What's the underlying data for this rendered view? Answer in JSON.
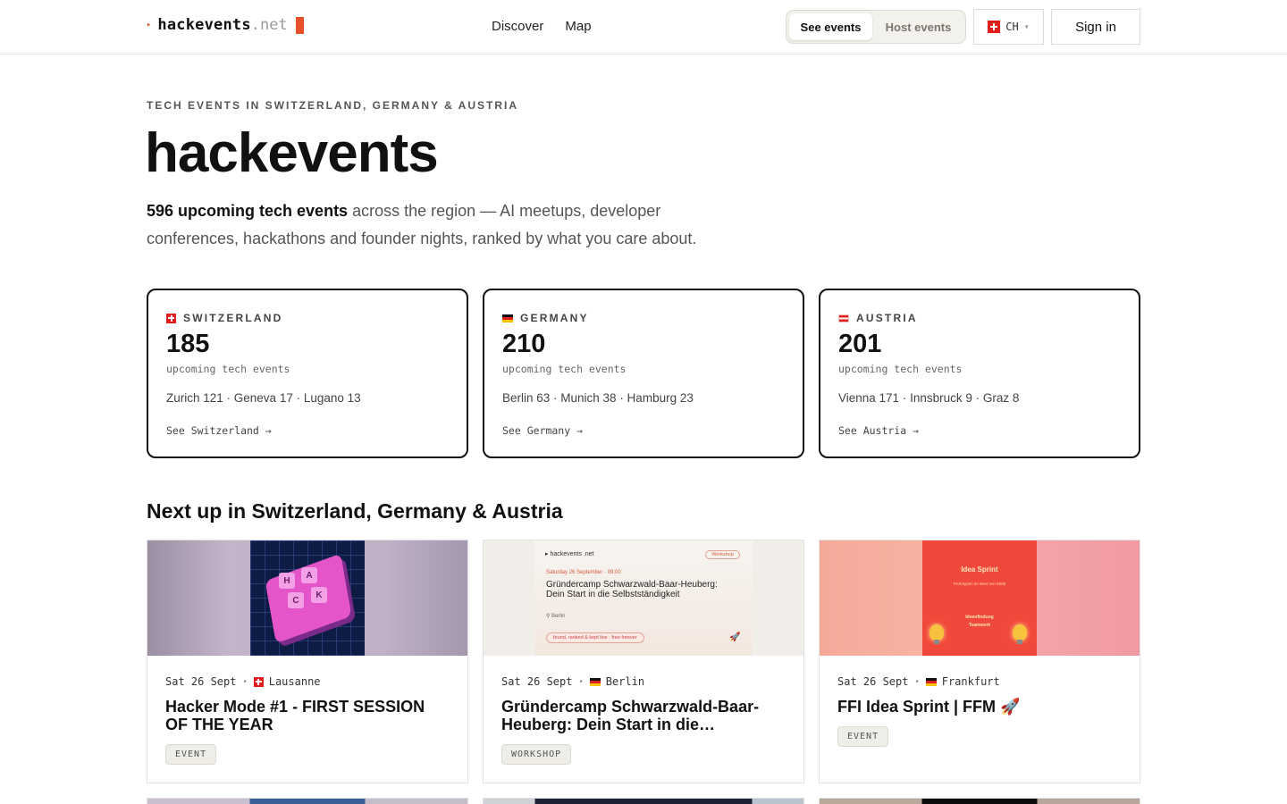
{
  "header": {
    "logo": {
      "arrow": "▸",
      "name": "hackevents",
      "tld": ".net"
    },
    "nav": [
      "Discover",
      "Map"
    ],
    "toggle": {
      "active": "See events",
      "inactive": "Host events"
    },
    "country_select": {
      "value": "CH",
      "caret": "▾"
    },
    "signin": "Sign in"
  },
  "hero": {
    "eyebrow": "TECH EVENTS IN SWITZERLAND, GERMANY & AUSTRIA",
    "title": "hackevents",
    "desc_bold": "596 upcoming tech events",
    "desc_rest": " across the region — AI meetups, developer conferences, hackathons and founder nights, ranked by what you care about."
  },
  "countries": [
    {
      "name": "SWITZERLAND",
      "flag": "ch",
      "count": "185",
      "sub": "upcoming tech events",
      "cities": "Zurich 121 · Geneva 17 · Lugano 13",
      "link": "See Switzerland →"
    },
    {
      "name": "GERMANY",
      "flag": "de",
      "count": "210",
      "sub": "upcoming tech events",
      "cities": "Berlin 63 · Munich 38 · Hamburg 23",
      "link": "See Germany →"
    },
    {
      "name": "AUSTRIA",
      "flag": "at",
      "count": "201",
      "sub": "upcoming tech events",
      "cities": "Vienna 171 · Innsbruck 9 · Graz 8",
      "link": "See Austria →"
    }
  ],
  "section_title": "Next up in Switzerland, Germany & Austria",
  "events": [
    {
      "date": "Sat 26 Sept",
      "sep": "·",
      "flag": "ch",
      "city": "Lausanne",
      "title": "Hacker Mode #1 - FIRST SESSION OF THE YEAR",
      "tag": "EVENT",
      "thumb": {
        "keys": [
          "H",
          "A",
          "C",
          "K"
        ]
      }
    },
    {
      "date": "Sat 26 Sept",
      "sep": "·",
      "flag": "de",
      "city": "Berlin",
      "title": "Gründercamp Schwarzwald-Baar-Heuberg: Dein Start in die…",
      "tag": "WORKSHOP",
      "thumb": {
        "brand": "▸ hackevents .net",
        "chip": "Workshop",
        "date": "Saturday 26 September · 09:00",
        "title": "Gründercamp Schwarzwald-Baar-Heuberg: Dein Start in die Selbstständigkeit",
        "loc": "⚲ Berlin",
        "pill": "found, ranked & kept live · free forever",
        "rocket": "🚀"
      }
    },
    {
      "date": "Sat 26 Sept",
      "sep": "·",
      "flag": "de",
      "city": "Frankfurt",
      "title": "FFI Idea Sprint | FFM 🚀",
      "tag": "EVENT",
      "thumb": {
        "title": "Idea Sprint",
        "sub": "Prototypen im Wert von 500€",
        "words": [
          "Ideenfindung",
          "Teamwork"
        ]
      }
    }
  ]
}
